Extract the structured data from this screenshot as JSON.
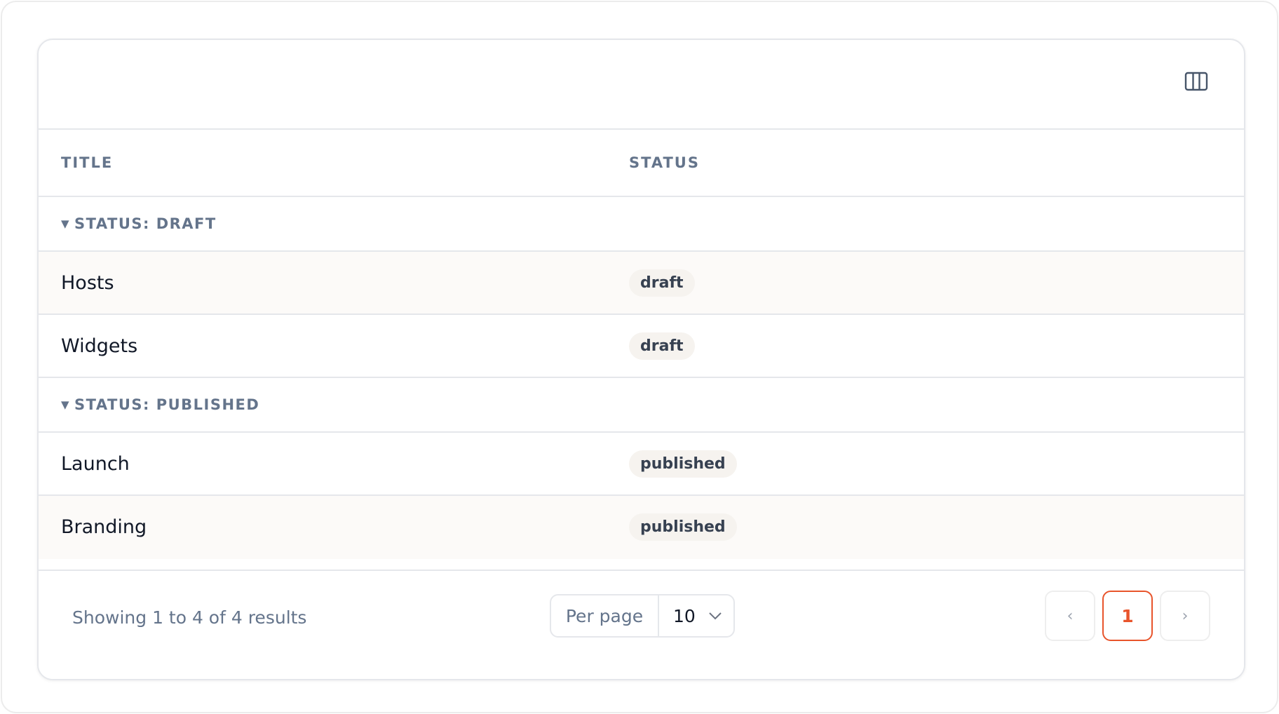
{
  "toolbar": {
    "columns_icon": "columns-icon"
  },
  "table": {
    "headers": {
      "title": "Title",
      "status": "Status"
    },
    "groups": [
      {
        "label": "Status: draft",
        "rows": [
          {
            "title": "Hosts",
            "status": "draft"
          },
          {
            "title": "Widgets",
            "status": "draft"
          }
        ]
      },
      {
        "label": "Status: published",
        "rows": [
          {
            "title": "Launch",
            "status": "published"
          },
          {
            "title": "Branding",
            "status": "published"
          }
        ]
      }
    ]
  },
  "footer": {
    "results_text": "Showing 1 to 4 of 4 results",
    "per_page_label": "Per page",
    "per_page_value": "10",
    "pagination": {
      "prev": "‹",
      "current": "1",
      "next": "›"
    }
  },
  "colors": {
    "accent": "#e8542b",
    "badge_bg": "#f6f3ef",
    "muted_text": "#64748b"
  }
}
